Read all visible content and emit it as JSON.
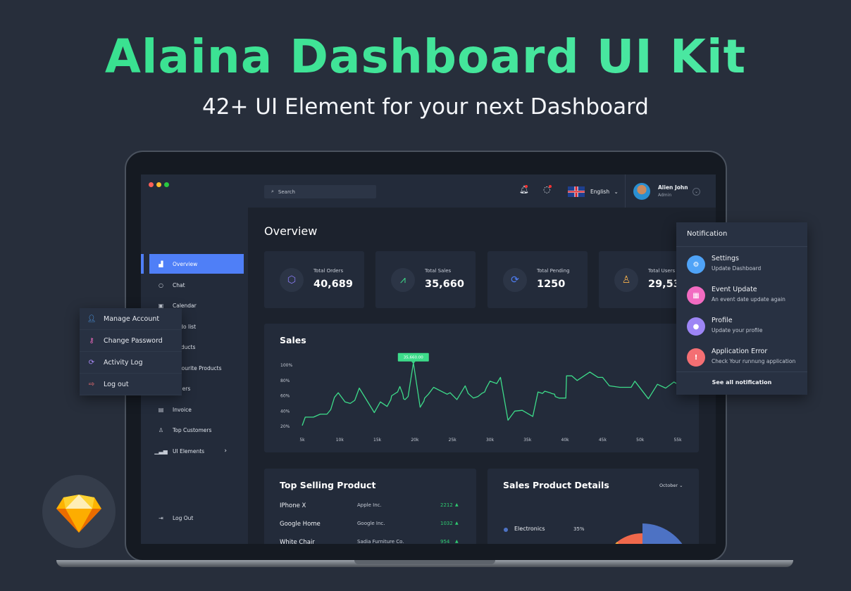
{
  "hero": {
    "title": "Alaina Dashboard UI Kit",
    "subtitle": "42+ UI Element for your next Dashboard"
  },
  "colors": {
    "accent": "#4f7ff7",
    "chart_line": "#3ddc8a",
    "title_green": "#3ee595",
    "window_red": "#ff5f57",
    "window_yellow": "#febc2e",
    "window_green": "#28c840"
  },
  "header": {
    "search_placeholder": "Search",
    "language": "English",
    "user_name": "Alien John",
    "user_role": "Admin",
    "icons": [
      "bell-icon",
      "chat-icon",
      "uk-flag-icon",
      "chevron-down-icon"
    ]
  },
  "sidebar": {
    "items": [
      {
        "label": "Overview",
        "icon": "bar-chart-icon",
        "active": true
      },
      {
        "label": "Chat",
        "icon": "chat-icon"
      },
      {
        "label": "Calendar",
        "icon": "calendar-icon"
      },
      {
        "label": "To do list",
        "icon": "checklist-icon"
      },
      {
        "label": "Products",
        "icon": "box-icon"
      },
      {
        "label": "Favourite Products",
        "icon": "heart-icon"
      },
      {
        "label": "Orders",
        "icon": "orders-icon"
      },
      {
        "label": "Invoice",
        "icon": "invoice-icon"
      },
      {
        "label": "Top Customers",
        "icon": "user-icon"
      },
      {
        "label": "UI Elements",
        "icon": "bars-icon"
      }
    ],
    "logout": "Log Out"
  },
  "main": {
    "title": "Overview",
    "stats": [
      {
        "label": "Total Orders",
        "value": "40,689",
        "icon": "cube-icon",
        "color": "#8a7cf7"
      },
      {
        "label": "Total Sales",
        "value": "35,660",
        "icon": "line-chart-icon",
        "color": "#3ddc8a"
      },
      {
        "label": "Total Pending",
        "value": "1250",
        "icon": "refresh-icon",
        "color": "#4f7ff7"
      },
      {
        "label": "Total Users",
        "value": "29,53",
        "icon": "user-icon",
        "color": "#f5b04c"
      }
    ]
  },
  "chart_data": {
    "type": "line",
    "title": "Sales",
    "xlim": [
      5,
      55
    ],
    "ylim": [
      20,
      100
    ],
    "x_ticks": [
      "5k",
      "10k",
      "15k",
      "20k",
      "25k",
      "30k",
      "35k",
      "40k",
      "45k",
      "50k",
      "55k"
    ],
    "y_ticks": [
      "100%",
      "80%",
      "60%",
      "40%",
      "20%"
    ],
    "tooltip": "35,660.00",
    "tooltip_x": 19.8,
    "tooltip_y": 103,
    "grid": false,
    "x": [
      5,
      5.4,
      6.5,
      7.4,
      8.3,
      8.8,
      9.3,
      9.8,
      10.7,
      11.4,
      12,
      12.6,
      14.6,
      15.4,
      16.3,
      16.8,
      16.9,
      17.7,
      18,
      18.4,
      18.5,
      18.7,
      19.1,
      19.8,
      20.7,
      21.2,
      21.3,
      21.8,
      22.5,
      24.3,
      24.7,
      25.6,
      26.7,
      27.1,
      27.8,
      28.4,
      28.9,
      29.3,
      29.5,
      30,
      30.9,
      31.4,
      32.4,
      33.3,
      34.3,
      35.7,
      36.4,
      37,
      37.3,
      38,
      38.2,
      38.6,
      38.7,
      39.2,
      40.1,
      40.2,
      40.9,
      41.6,
      43.3,
      44.4,
      45,
      45.9,
      47.3,
      48.8,
      49.3,
      51.1,
      52.3,
      53.4,
      54.5,
      55
    ],
    "y": [
      21,
      32,
      32,
      36,
      36,
      42,
      58,
      64,
      52,
      50,
      54,
      70,
      38,
      52,
      46,
      55,
      60,
      65,
      72,
      62,
      56,
      55,
      59,
      103,
      45,
      53,
      57,
      62,
      71,
      62,
      64,
      55,
      73,
      63,
      57,
      59,
      63,
      65,
      70,
      79,
      76,
      84,
      28,
      40,
      41,
      33,
      65,
      63,
      66,
      64,
      63,
      62,
      59,
      57,
      57,
      86,
      86,
      80,
      91,
      84,
      84,
      73,
      71,
      71,
      79,
      56,
      75,
      70,
      78,
      75
    ]
  },
  "top_selling": {
    "title": "Top Selling Product",
    "rows": [
      {
        "name": "IPhone X",
        "company": "Apple Inc.",
        "value": "2212"
      },
      {
        "name": "Google Home",
        "company": "Google Inc.",
        "value": "1032"
      },
      {
        "name": "White Chair",
        "company": "Sadia Furniture Co.",
        "value": "954"
      }
    ]
  },
  "sales_details": {
    "title": "Sales Product Details",
    "month": "October",
    "legend": [
      {
        "label": "Electronics",
        "value": "35%",
        "color": "#4d72c4"
      }
    ]
  },
  "notification": {
    "title": "Notification",
    "items": [
      {
        "title": "Settings",
        "subtitle": "Update Dashboard",
        "icon": "gear-icon",
        "color": "#4fa3f7"
      },
      {
        "title": "Event Update",
        "subtitle": "An event date update again",
        "icon": "calendar-icon",
        "color": "#f26bc1"
      },
      {
        "title": "Profile",
        "subtitle": "Update your profile",
        "icon": "user-icon",
        "color": "#9d85f5"
      },
      {
        "title": "Application Error",
        "subtitle": "Check Your runnung application",
        "icon": "alert-icon",
        "color": "#f46f73"
      }
    ],
    "see_all": "See all notification"
  },
  "account_menu": {
    "items": [
      {
        "label": "Manage Account",
        "icon": "user-gear-icon",
        "color": "#4fa3f7"
      },
      {
        "label": "Change Password",
        "icon": "key-icon",
        "color": "#f26bc1"
      },
      {
        "label": "Activity Log",
        "icon": "refresh-icon",
        "color": "#a98af7"
      },
      {
        "label": "Log out",
        "icon": "logout-icon",
        "color": "#f46f73"
      }
    ]
  },
  "logo": {
    "icon": "sketch-diamond-icon"
  }
}
